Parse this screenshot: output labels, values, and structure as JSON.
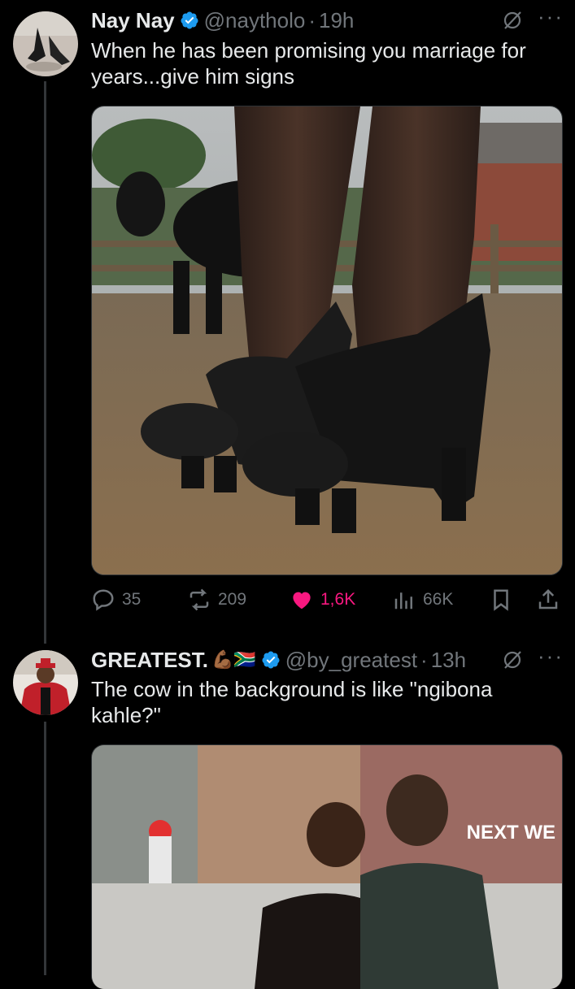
{
  "tweets": [
    {
      "author_name": "Nay Nay",
      "handle": "@naytholo",
      "separator": "·",
      "time": "19h",
      "text": "When he has been promising you marriage for years...give him signs",
      "media_icon": "cow-hoof-heels-photo",
      "stats": {
        "replies": "35",
        "reposts": "209",
        "likes": "1,6K",
        "views": "66K"
      }
    },
    {
      "author_name": "GREATEST.",
      "name_emojis": "💪🏾🇿🇦",
      "handle": "@by_greatest",
      "separator": "·",
      "time": "13h",
      "text": "The cow in the background is like \"ngibona kahle?\"",
      "media_icon": "tv-show-couple-photo",
      "media_overlay": "NEXT WE"
    }
  ],
  "colors": {
    "background": "#000000",
    "text": "#e7e9ea",
    "muted": "#71767b",
    "like": "#f91880",
    "verified": "#1d9bf0"
  }
}
